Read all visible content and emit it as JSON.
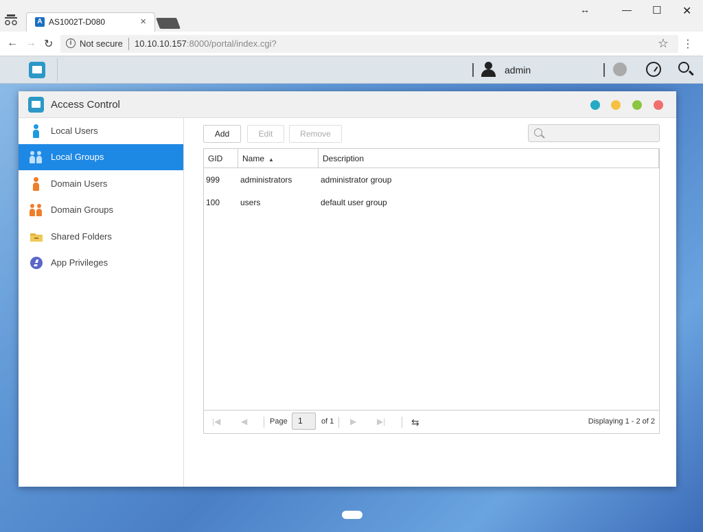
{
  "browser": {
    "tab_title": "AS1002T-D080",
    "security_text": "Not secure",
    "url_host": "10.10.10.157",
    "url_rest": ":8000/portal/index.cgi?"
  },
  "taskbar": {
    "user_name": "admin"
  },
  "window": {
    "title": "Access Control",
    "dot_colors": [
      "#26a9c3",
      "#f6c142",
      "#8cc63f",
      "#f26d6d"
    ]
  },
  "sidebar": {
    "items": [
      {
        "label": "Local Users",
        "icon": "user-icon",
        "color": "#1e9ae0"
      },
      {
        "label": "Local Groups",
        "icon": "users-icon",
        "color": "#ffffff"
      },
      {
        "label": "Domain Users",
        "icon": "user-icon",
        "color": "#f07d2a"
      },
      {
        "label": "Domain Groups",
        "icon": "users-icon",
        "color": "#f07d2a"
      },
      {
        "label": "Shared Folders",
        "icon": "folder-icon",
        "color": "#e4b43c"
      },
      {
        "label": "App Privileges",
        "icon": "app-icon",
        "color": "#5a67c8"
      }
    ],
    "active_index": 1
  },
  "toolbar": {
    "add_label": "Add",
    "edit_label": "Edit",
    "remove_label": "Remove"
  },
  "table": {
    "columns": [
      "GID",
      "Name",
      "Description"
    ],
    "rows": [
      {
        "gid": "999",
        "name": "administrators",
        "description": "administrator group"
      },
      {
        "gid": "100",
        "name": "users",
        "description": "default user group"
      }
    ]
  },
  "pager": {
    "page_label": "Page",
    "page_value": "1",
    "of_label": "of 1",
    "display_text": "Displaying 1 - 2 of 2"
  }
}
